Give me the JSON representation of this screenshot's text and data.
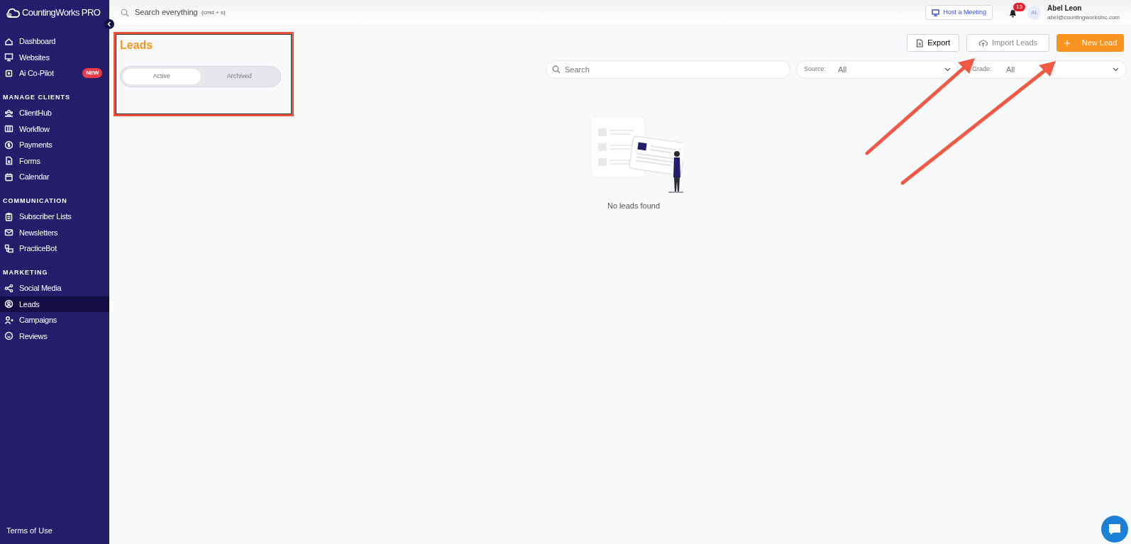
{
  "brand": {
    "name": "CountingWorks",
    "tier": "PRO"
  },
  "sidebar": {
    "groups": [
      {
        "items": [
          {
            "label": "Dashboard",
            "selected": false
          },
          {
            "label": "Websites",
            "selected": false
          },
          {
            "label": "Ai Co-Pilot",
            "selected": false,
            "badge": "NEW"
          }
        ]
      },
      {
        "heading": "MANAGE CLIENTS",
        "items": [
          {
            "label": "ClientHub",
            "selected": false
          },
          {
            "label": "Workflow",
            "selected": false
          },
          {
            "label": "Payments",
            "selected": false
          },
          {
            "label": "Forms",
            "selected": false
          },
          {
            "label": "Calendar",
            "selected": false
          }
        ]
      },
      {
        "heading": "COMMUNICATION",
        "items": [
          {
            "label": "Subscriber Lists",
            "selected": false
          },
          {
            "label": "Newsletters",
            "selected": false
          },
          {
            "label": "PracticeBot",
            "selected": false
          }
        ]
      },
      {
        "heading": "MARKETING",
        "items": [
          {
            "label": "Social Media",
            "selected": false
          },
          {
            "label": "Leads",
            "selected": true
          },
          {
            "label": "Campaigns",
            "selected": false
          },
          {
            "label": "Reviews",
            "selected": false
          }
        ]
      }
    ],
    "footer": "Terms of Use"
  },
  "topbar": {
    "search": {
      "placeholder": "Search everything",
      "shortcut": "(cmd + s)"
    },
    "meeting_button": "Host a Meeting",
    "notifications": "13",
    "user": {
      "initials": "AL",
      "name": "Abel Leon",
      "email": "abel@countingworksinc.com"
    }
  },
  "page": {
    "title": "Leads",
    "tabs": [
      {
        "label": "Active",
        "selected": true
      },
      {
        "label": "Archived",
        "selected": false
      }
    ],
    "actions": [
      {
        "label": "Export",
        "kind": "export"
      },
      {
        "label": "Import Leads",
        "kind": "import"
      },
      {
        "label": "New Lead",
        "kind": "new"
      }
    ],
    "search": {
      "placeholder": "Search"
    },
    "filters": [
      {
        "label": "Source:",
        "value": "All"
      },
      {
        "label": "Grade:",
        "value": "All"
      }
    ],
    "empty_message": "No leads found"
  }
}
